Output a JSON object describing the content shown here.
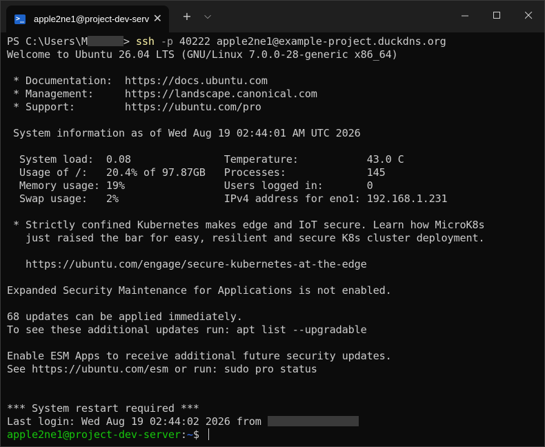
{
  "tab": {
    "icon": "powershell-icon",
    "title": "apple2ne1@project-dev-serve",
    "close_glyph": "✕"
  },
  "toolbar": {
    "new_tab_glyph": "+",
    "dropdown_glyph": "⌵"
  },
  "window_controls": {
    "minimize_glyph": "—",
    "maximize_glyph": "☐",
    "close_glyph": "✕"
  },
  "terminal": {
    "cmd_prompt_prefix": "PS C:\\Users\\M",
    "cmd_prompt_suffix": "> ",
    "cmd_ssh": "ssh",
    "cmd_flag": " -p ",
    "cmd_port": "40222",
    "cmd_target": " apple2ne1@example-project.duckdns.org",
    "lines": [
      "Welcome to Ubuntu 26.04 LTS (GNU/Linux 7.0.0-28-generic x86_64)",
      "",
      " * Documentation:  https://docs.ubuntu.com",
      " * Management:     https://landscape.canonical.com",
      " * Support:        https://ubuntu.com/pro",
      "",
      " System information as of Wed Aug 19 02:44:01 AM UTC 2026",
      "",
      "  System load:  0.08               Temperature:           43.0 C",
      "  Usage of /:   20.4% of 97.87GB   Processes:             145",
      "  Memory usage: 19%                Users logged in:       0",
      "  Swap usage:   2%                 IPv4 address for eno1: 192.168.1.231",
      "",
      " * Strictly confined Kubernetes makes edge and IoT secure. Learn how MicroK8s",
      "   just raised the bar for easy, resilient and secure K8s cluster deployment.",
      "",
      "   https://ubuntu.com/engage/secure-kubernetes-at-the-edge",
      "",
      "Expanded Security Maintenance for Applications is not enabled.",
      "",
      "68 updates can be applied immediately.",
      "To see these additional updates run: apt list --upgradable",
      "",
      "Enable ESM Apps to receive additional future security updates.",
      "See https://ubuntu.com/esm or run: sudo pro status",
      "",
      "",
      "*** System restart required ***"
    ],
    "last_login": "Last login: Wed Aug 19 02:44:02 2026 from ",
    "prompt_user": "apple2ne1@project-dev-server",
    "prompt_sep": ":",
    "prompt_path": "~",
    "prompt_symbol": "$ "
  },
  "colors": {
    "background": "#0c0c0c",
    "foreground": "#cccccc",
    "prompt_green": "#16c60c",
    "path_blue": "#3b78ff",
    "titlebar": "#1f1f1f"
  }
}
